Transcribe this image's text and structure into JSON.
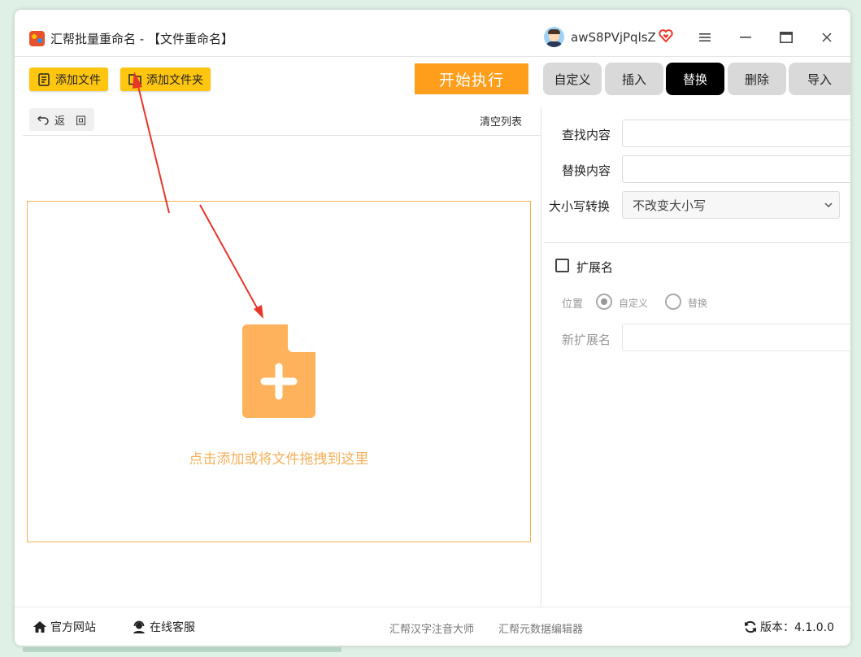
{
  "window": {
    "title": "汇帮批量重命名 - 【文件重命名】",
    "username": "awS8PVjPqlsZ"
  },
  "toolbar": {
    "add_file": "添加文件",
    "add_folder": "添加文件夹",
    "start": "开始执行"
  },
  "tabs": [
    {
      "label": "自定义",
      "active": false
    },
    {
      "label": "插入",
      "active": false
    },
    {
      "label": "替换",
      "active": true
    },
    {
      "label": "删除",
      "active": false
    },
    {
      "label": "导入",
      "active": false
    }
  ],
  "file_list": {
    "back": "返　回",
    "clear": "清空列表",
    "drop_hint": "点击添加或将文件拖拽到这里"
  },
  "replace_panel": {
    "find_label": "查找内容",
    "find_value": "",
    "replace_label": "替换内容",
    "replace_value": "",
    "case_label": "大小写转换",
    "case_selected": "不改变大小写",
    "extension_label": "扩展名",
    "extension_checked": false,
    "position_label": "位置",
    "position_options": [
      "自定义",
      "替换"
    ],
    "position_selected": "自定义",
    "new_ext_label": "新扩展名",
    "new_ext_value": ""
  },
  "footer": {
    "website": "官方网站",
    "support": "在线客服",
    "link1": "汇帮汉字注音大师",
    "link2": "汇帮元数据编辑器",
    "version": "版本：4.1.0.0"
  },
  "colors": {
    "accent_yellow": "#ffc611",
    "start_orange": "#ff9e1b",
    "drop_border": "#f5b24c",
    "drop_icon": "#ffb25c",
    "annotation_arrow": "#e8352a"
  }
}
